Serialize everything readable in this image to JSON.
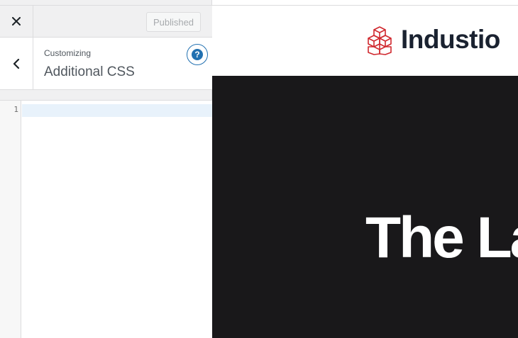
{
  "sidebar": {
    "close_icon": "close-icon",
    "publish_label": "Published",
    "back_icon": "chevron-left-icon",
    "customizing_label": "Customizing",
    "section_title": "Additional CSS",
    "help_icon": "help-icon",
    "help_glyph": "?"
  },
  "editor": {
    "line_numbers": [
      "1"
    ],
    "content": ""
  },
  "preview": {
    "site_name": "Industio",
    "hero_title": "The La",
    "colors": {
      "logo_red": "#d0282e",
      "logo_text": "#1a2230",
      "hero_bg": "#19181a",
      "accent": "#2271b1"
    }
  }
}
